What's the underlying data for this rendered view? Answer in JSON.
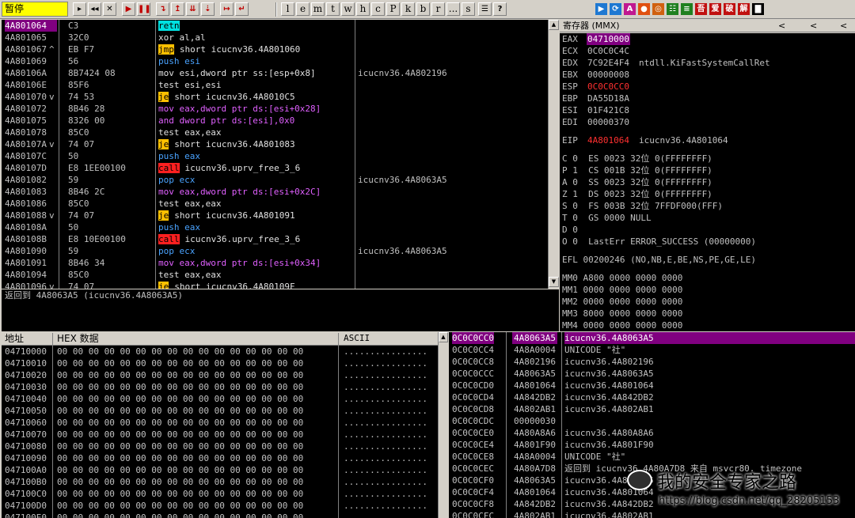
{
  "toolbar": {
    "status": "暂停",
    "buttons_left": [
      "▸",
      "◂◂",
      "✕",
      "▶",
      "❚❚",
      "↴",
      "↥",
      "⇊",
      "⇣",
      "↦",
      "↵"
    ],
    "letters": [
      "l",
      "e",
      "m",
      "t",
      "w",
      "h",
      "c",
      "P",
      "k",
      "b",
      "r",
      "...",
      "s"
    ],
    "buttons_right": [
      "☰",
      "?"
    ],
    "plugin_icons": [
      "▶",
      "⟳",
      "A",
      "●",
      "◎",
      "☷",
      "≡",
      "吾",
      "爱",
      "破",
      "解",
      "▇"
    ]
  },
  "disasm": {
    "rows": [
      {
        "addr": "4A801064",
        "mark": "",
        "hex": "C3",
        "code": "retn",
        "kw": "retn",
        "style": "cyan",
        "cmt": ""
      },
      {
        "addr": "4A801065",
        "mark": "",
        "hex": "32C0",
        "code": "xor al,al",
        "kw": "",
        "style": "",
        "cmt": ""
      },
      {
        "addr": "4A801067",
        "mark": "^",
        "hex": "EB F7",
        "code": "short icucnv36.4A801060",
        "kw": "jmp",
        "style": "yellow",
        "cmt": ""
      },
      {
        "addr": "4A801069",
        "mark": "",
        "hex": "56",
        "code": "push esi",
        "kw": "",
        "style": "blue",
        "cmt": ""
      },
      {
        "addr": "4A80106A",
        "mark": "",
        "hex": "8B7424 08",
        "code": "mov esi,dword ptr ss:[esp+0x8]",
        "kw": "",
        "style": "white",
        "cmt": "icucnv36.4A802196"
      },
      {
        "addr": "4A80106E",
        "mark": "",
        "hex": "85F6",
        "code": "test esi,esi",
        "kw": "",
        "style": "",
        "cmt": ""
      },
      {
        "addr": "4A801070",
        "mark": "v",
        "hex": "74 53",
        "code": "short icucnv36.4A8010C5",
        "kw": "je",
        "style": "yellow",
        "cmt": ""
      },
      {
        "addr": "4A801072",
        "mark": "",
        "hex": "8B46 28",
        "code": "mov eax,dword ptr ds:[esi+0x28]",
        "kw": "",
        "style": "mag",
        "cmt": ""
      },
      {
        "addr": "4A801075",
        "mark": "",
        "hex": "8326 00",
        "code": "and dword ptr ds:[esi],0x0",
        "kw": "",
        "style": "mag",
        "cmt": ""
      },
      {
        "addr": "4A801078",
        "mark": "",
        "hex": "85C0",
        "code": "test eax,eax",
        "kw": "",
        "style": "",
        "cmt": ""
      },
      {
        "addr": "4A80107A",
        "mark": "v",
        "hex": "74 07",
        "code": "short icucnv36.4A801083",
        "kw": "je",
        "style": "yellow",
        "cmt": ""
      },
      {
        "addr": "4A80107C",
        "mark": "",
        "hex": "50",
        "code": "push eax",
        "kw": "",
        "style": "blue",
        "cmt": ""
      },
      {
        "addr": "4A80107D",
        "mark": "",
        "hex": "E8 1EE00100",
        "code": "icucnv36.uprv_free_3_6",
        "kw": "call",
        "style": "red",
        "cmt": ""
      },
      {
        "addr": "4A801082",
        "mark": "",
        "hex": "59",
        "code": "pop ecx",
        "kw": "",
        "style": "blue",
        "cmt": "icucnv36.4A8063A5"
      },
      {
        "addr": "4A801083",
        "mark": "",
        "hex": "8B46 2C",
        "code": "mov eax,dword ptr ds:[esi+0x2C]",
        "kw": "",
        "style": "mag",
        "cmt": ""
      },
      {
        "addr": "4A801086",
        "mark": "",
        "hex": "85C0",
        "code": "test eax,eax",
        "kw": "",
        "style": "",
        "cmt": ""
      },
      {
        "addr": "4A801088",
        "mark": "v",
        "hex": "74 07",
        "code": "short icucnv36.4A801091",
        "kw": "je",
        "style": "yellow",
        "cmt": ""
      },
      {
        "addr": "4A80108A",
        "mark": "",
        "hex": "50",
        "code": "push eax",
        "kw": "",
        "style": "blue",
        "cmt": ""
      },
      {
        "addr": "4A80108B",
        "mark": "",
        "hex": "E8 10E00100",
        "code": "icucnv36.uprv_free_3_6",
        "kw": "call",
        "style": "red",
        "cmt": ""
      },
      {
        "addr": "4A801090",
        "mark": "",
        "hex": "59",
        "code": "pop ecx",
        "kw": "",
        "style": "blue",
        "cmt": "icucnv36.4A8063A5"
      },
      {
        "addr": "4A801091",
        "mark": "",
        "hex": "8B46 34",
        "code": "mov eax,dword ptr ds:[esi+0x34]",
        "kw": "",
        "style": "mag",
        "cmt": ""
      },
      {
        "addr": "4A801094",
        "mark": "",
        "hex": "85C0",
        "code": "test eax,eax",
        "kw": "",
        "style": "",
        "cmt": ""
      },
      {
        "addr": "4A801096",
        "mark": "v",
        "hex": "74 07",
        "code": "short icucnv36.4A80109F",
        "kw": "je",
        "style": "yellow",
        "cmt": ""
      }
    ]
  },
  "info": {
    "text": "返回到 4A8063A5 (icucnv36.4A8063A5)"
  },
  "registers": {
    "title": "寄存器 (MMX)",
    "nav": [
      "<",
      "<",
      "<"
    ],
    "gp": [
      {
        "k": "EAX",
        "v": "04710000",
        "cmt": "",
        "sel": true
      },
      {
        "k": "ECX",
        "v": "0C0C0C4C",
        "cmt": ""
      },
      {
        "k": "EDX",
        "v": "7C92E4F4",
        "cmt": "ntdll.KiFastSystemCallRet"
      },
      {
        "k": "EBX",
        "v": "00000008",
        "cmt": ""
      },
      {
        "k": "ESP",
        "v": "0C0C0CC0",
        "cmt": "",
        "red": true
      },
      {
        "k": "EBP",
        "v": "DA55D18A",
        "cmt": ""
      },
      {
        "k": "ESI",
        "v": "01F421C8",
        "cmt": ""
      },
      {
        "k": "EDI",
        "v": "00000370",
        "cmt": ""
      }
    ],
    "eip": {
      "k": "EIP",
      "v": "4A801064",
      "cmt": "icucnv36.4A801064"
    },
    "flags": [
      "C 0  ES 0023 32位 0(FFFFFFFF)",
      "P 1  CS 001B 32位 0(FFFFFFFF)",
      "A 0  SS 0023 32位 0(FFFFFFFF)",
      "Z 1  DS 0023 32位 0(FFFFFFFF)",
      "S 0  FS 003B 32位 7FFDF000(FFF)",
      "T 0  GS 0000 NULL",
      "D 0",
      "O 0  LastErr ERROR_SUCCESS (00000000)"
    ],
    "efl": "EFL 00200246 (NO,NB,E,BE,NS,PE,GE,LE)",
    "mmx": [
      "MM0 A800 0000 0000 0000",
      "MM1 0000 0000 0000 0000",
      "MM2 0000 0000 0000 0000",
      "MM3 8000 0000 0000 0000",
      "MM4 0000 0000 0000 0000"
    ]
  },
  "dump": {
    "headers": {
      "addr": "地址",
      "hex": "HEX 数据",
      "ascii": "ASCII"
    },
    "hex": "00 00 00 00 00 00 00 00 00 00 00 00 00 00 00 00",
    "ascii": "................",
    "rows": [
      "04710000",
      "04710010",
      "04710020",
      "04710030",
      "04710040",
      "04710050",
      "04710060",
      "04710070",
      "04710080",
      "04710090",
      "047100A0",
      "047100B0",
      "047100C0",
      "047100D0",
      "047100E0"
    ]
  },
  "stack": {
    "rows": [
      {
        "a": "0C0C0CC0",
        "v": "4A8063A5",
        "c": "icucnv36.4A8063A5",
        "sel": true
      },
      {
        "a": "0C0C0CC4",
        "v": "4A8A0004",
        "c": "UNICODE \"社\""
      },
      {
        "a": "0C0C0CC8",
        "v": "4A802196",
        "c": "icucnv36.4A802196"
      },
      {
        "a": "0C0C0CCC",
        "v": "4A8063A5",
        "c": "icucnv36.4A8063A5"
      },
      {
        "a": "0C0C0CD0",
        "v": "4A801064",
        "c": "icucnv36.4A801064"
      },
      {
        "a": "0C0C0CD4",
        "v": "4A842DB2",
        "c": "icucnv36.4A842DB2"
      },
      {
        "a": "0C0C0CD8",
        "v": "4A802AB1",
        "c": "icucnv36.4A802AB1"
      },
      {
        "a": "0C0C0CDC",
        "v": "00000030",
        "c": ""
      },
      {
        "a": "0C0C0CE0",
        "v": "4A80A8A6",
        "c": "icucnv36.4A80A8A6"
      },
      {
        "a": "0C0C0CE4",
        "v": "4A801F90",
        "c": "icucnv36.4A801F90"
      },
      {
        "a": "0C0C0CE8",
        "v": "4A8A0004",
        "c": "UNICODE \"社\""
      },
      {
        "a": "0C0C0CEC",
        "v": "4A80A7D8",
        "c": "返回到 icucnv36.4A80A7D8 来自 msvcr80._timezone"
      },
      {
        "a": "0C0C0CF0",
        "v": "4A8063A5",
        "c": "icucnv36.4A8063A5"
      },
      {
        "a": "0C0C0CF4",
        "v": "4A801064",
        "c": "icucnv36.4A801064"
      },
      {
        "a": "0C0C0CF8",
        "v": "4A842DB2",
        "c": "icucnv36.4A842DB2"
      },
      {
        "a": "0C0C0CFC",
        "v": "4A802AB1",
        "c": "icucnv36.4A802AB1"
      }
    ]
  },
  "watermark": {
    "title": "我的安全专家之路",
    "url": "https://blog.csdn.net/qq_28205153"
  }
}
